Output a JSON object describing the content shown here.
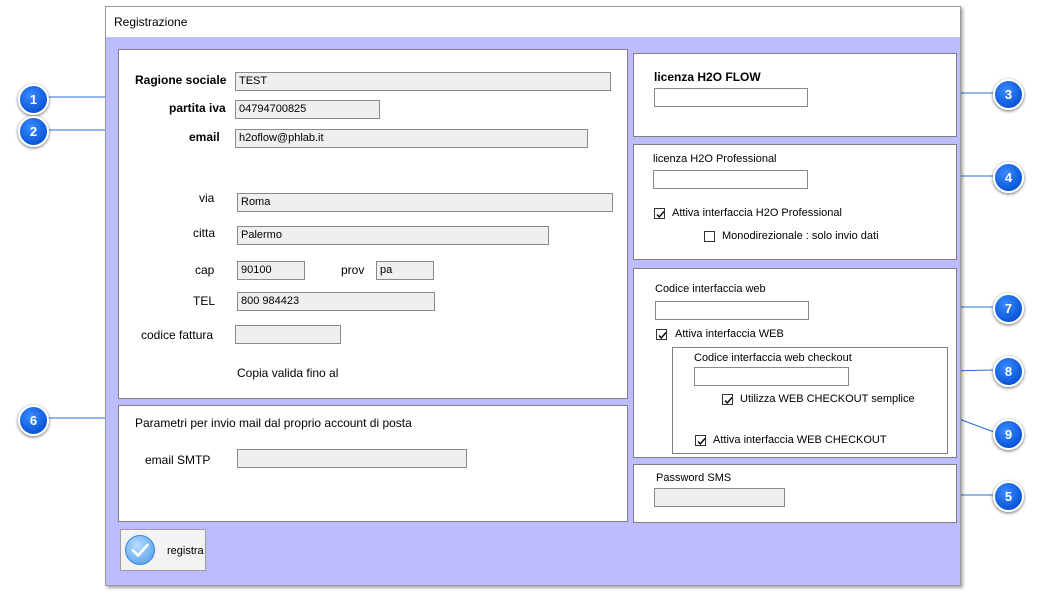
{
  "window": {
    "title": "Registrazione"
  },
  "company": {
    "ragione_sociale_label": "Ragione sociale",
    "ragione_sociale_value": "TEST",
    "partita_iva_label": "partita iva",
    "partita_iva_value": "04794700825",
    "email_label": "email",
    "email_value": "h2oflow@phlab.it",
    "via_label": "via",
    "via_value": "Roma",
    "citta_label": "citta",
    "citta_value": "Palermo",
    "cap_label": "cap",
    "cap_value": "90100",
    "prov_label": "prov",
    "prov_value": "pa",
    "tel_label": "TEL",
    "tel_value": "800 984423",
    "codice_fattura_label": "codice fattura",
    "codice_fattura_value": "",
    "copia_valida_label": "Copia valida fino al"
  },
  "mail": {
    "title": "Parametri per invio mail dal proprio account di posta",
    "smtp_label": "email SMTP",
    "smtp_value": ""
  },
  "flow": {
    "label": "licenza H2O FLOW",
    "value": ""
  },
  "professional": {
    "label": "licenza  H2O Professional",
    "value": "",
    "attiva_label": "Attiva interfaccia H2O Professional",
    "attiva_checked": true,
    "mono_label": "Monodirezionale : solo invio dati",
    "mono_checked": false
  },
  "web": {
    "code_label": "Codice interfaccia web",
    "code_value": "",
    "attiva_label": "Attiva interfaccia WEB",
    "attiva_checked": true,
    "checkout_label": "Codice interfaccia web checkout",
    "checkout_value": "",
    "semplice_label": "Utilizza WEB CHECKOUT semplice",
    "semplice_checked": true,
    "attiva_checkout_label": "Attiva interfaccia WEB CHECKOUT",
    "attiva_checkout_checked": true
  },
  "sms": {
    "label": "Password SMS",
    "value": ""
  },
  "registra_button": {
    "label": "registra"
  },
  "callouts": [
    "1",
    "2",
    "3",
    "4",
    "5",
    "6",
    "7",
    "8",
    "9"
  ],
  "colors": {
    "client_bg": "#bcbcff",
    "callout": "#1565e0",
    "line": "#2a6fd6"
  }
}
